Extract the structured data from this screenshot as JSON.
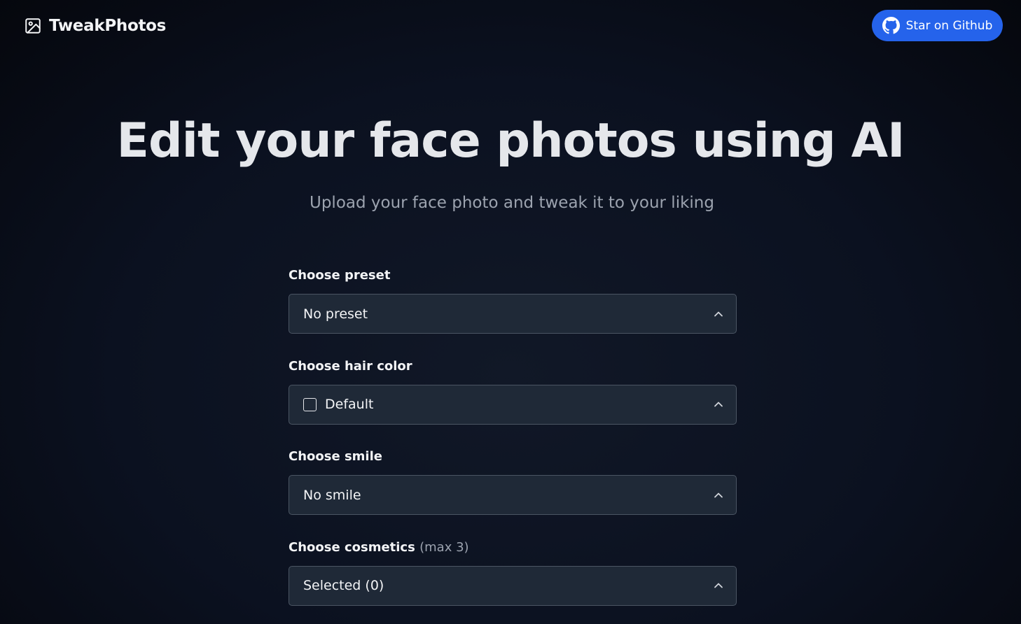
{
  "header": {
    "brand": "TweakPhotos",
    "github_button": "Star on Github"
  },
  "hero": {
    "title": "Edit your face photos using AI",
    "subtitle": "Upload your face photo and tweak it to your liking"
  },
  "form": {
    "preset": {
      "label": "Choose preset",
      "value": "No preset"
    },
    "hair_color": {
      "label": "Choose hair color",
      "value": "Default"
    },
    "smile": {
      "label": "Choose smile",
      "value": "No smile"
    },
    "cosmetics": {
      "label": "Choose cosmetics",
      "hint": "(max 3)",
      "value": "Selected (0)"
    }
  },
  "colors": {
    "accent": "#2563eb",
    "background": "#0b1120",
    "field_background": "#1f2937",
    "field_border": "#4b5563",
    "muted_text": "#9ca3af"
  },
  "icons": {
    "logo": "photo-icon",
    "github": "github-icon",
    "dropdown": "chevron-up-icon"
  }
}
